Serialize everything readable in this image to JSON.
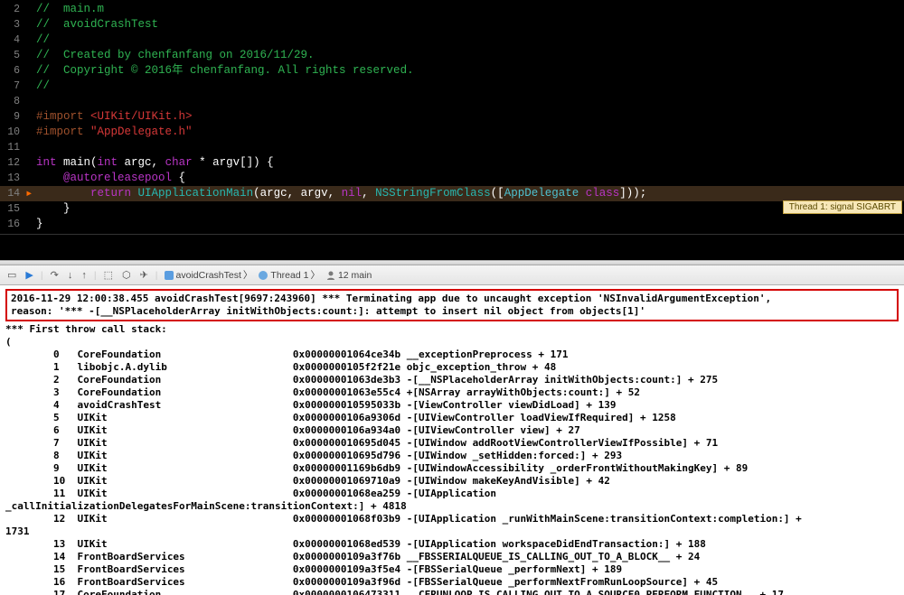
{
  "editor": {
    "lines": {
      "2": {
        "num": "2",
        "comment": "//  main.m"
      },
      "3": {
        "num": "3",
        "comment": "//  avoidCrashTest"
      },
      "4": {
        "num": "4",
        "comment": "//"
      },
      "5": {
        "num": "5",
        "comment": "//  Created by chenfanfang on 2016/11/29."
      },
      "6": {
        "num": "6",
        "comment": "//  Copyright © 2016年 chenfanfang. All rights reserved."
      },
      "7": {
        "num": "7",
        "comment": "//"
      },
      "8": {
        "num": "8"
      },
      "9": {
        "num": "9",
        "import_kw": "#import ",
        "import_val": "<UIKit/UIKit.h>"
      },
      "10": {
        "num": "10",
        "import_kw": "#import ",
        "import_val": "\"AppDelegate.h\""
      },
      "11": {
        "num": "11"
      },
      "12": {
        "num": "12",
        "type1": "int",
        "func": " main(",
        "type2": "int",
        "arg1": " argc, ",
        "type3": "char",
        "arg2": " * argv[]) {",
        "full_args": " argc, char * argv[]) {"
      },
      "13": {
        "num": "13",
        "indent": "    ",
        "autorelease": "@autoreleasepool",
        "brace": " {"
      },
      "14": {
        "num": "14",
        "indent": "        ",
        "return_kw": "return",
        "space": " ",
        "app_main": "UIApplicationMain",
        "open": "(argc, argv, ",
        "nil": "nil",
        "comma": ", ",
        "ns_string": "NSStringFromClass",
        "open2": "([",
        "appdel": "AppDelegate",
        "space2": " ",
        "class_kw": "class",
        "close": "]));"
      },
      "15": {
        "num": "15",
        "brace": "    }"
      },
      "16": {
        "num": "16",
        "brace": "}"
      }
    },
    "thread_badge": "Thread 1: signal SIGABRT"
  },
  "debug_bar": {
    "crumb1": "avoidCrashTest",
    "crumb2": "Thread 1",
    "crumb3": "12 main"
  },
  "console": {
    "error_line1": "2016-11-29 12:00:38.455 avoidCrashTest[9697:243960] *** Terminating app due to uncaught exception 'NSInvalidArgumentException',",
    "error_line2": "reason: '*** -[__NSPlaceholderArray initWithObjects:count:]: attempt to insert nil object from objects[1]'",
    "first_throw": "*** First throw call stack:",
    "open_paren": "(",
    "stack": [
      "\t0   CoreFoundation                      0x00000001064ce34b __exceptionPreprocess + 171",
      "\t1   libobjc.A.dylib                     0x0000000105f2f21e objc_exception_throw + 48",
      "\t2   CoreFoundation                      0x00000001063de3b3 -[__NSPlaceholderArray initWithObjects:count:] + 275",
      "\t3   CoreFoundation                      0x00000001063e55c4 +[NSArray arrayWithObjects:count:] + 52",
      "\t4   avoidCrashTest                      0x000000010595033b -[ViewController viewDidLoad] + 139",
      "\t5   UIKit                               0x0000000106a9306d -[UIViewController loadViewIfRequired] + 1258",
      "\t6   UIKit                               0x0000000106a934a0 -[UIViewController view] + 27",
      "\t7   UIKit                               0x000000010695d045 -[UIWindow addRootViewControllerViewIfPossible] + 71",
      "\t8   UIKit                               0x000000010695d796 -[UIWindow _setHidden:forced:] + 293",
      "\t9   UIKit                               0x00000001169b6db9 -[UIWindowAccessibility _orderFrontWithoutMakingKey] + 89",
      "\t10  UIKit                               0x00000001069710a9 -[UIWindow makeKeyAndVisible] + 42",
      "\t11  UIKit                               0x00000001068ea259 -[UIApplication",
      "_callInitializationDelegatesForMainScene:transitionContext:] + 4818",
      "\t12  UIKit                               0x00000001068f03b9 -[UIApplication _runWithMainScene:transitionContext:completion:] +",
      "1731",
      "\t13  UIKit                               0x00000001068ed539 -[UIApplication workspaceDidEndTransaction:] + 188",
      "\t14  FrontBoardServices                  0x0000000109a3f76b __FBSSERIALQUEUE_IS_CALLING_OUT_TO_A_BLOCK__ + 24",
      "\t15  FrontBoardServices                  0x0000000109a3f5e4 -[FBSSerialQueue _performNext] + 189",
      "\t16  FrontBoardServices                  0x0000000109a3f96d -[FBSSerialQueue _performNextFromRunLoopSource] + 45",
      "\t17  CoreFoundation                      0x0000000106473311 __CFRUNLOOP_IS_CALLING_OUT_TO_A_SOURCE0_PERFORM_FUNCTION__ + 17"
    ]
  }
}
